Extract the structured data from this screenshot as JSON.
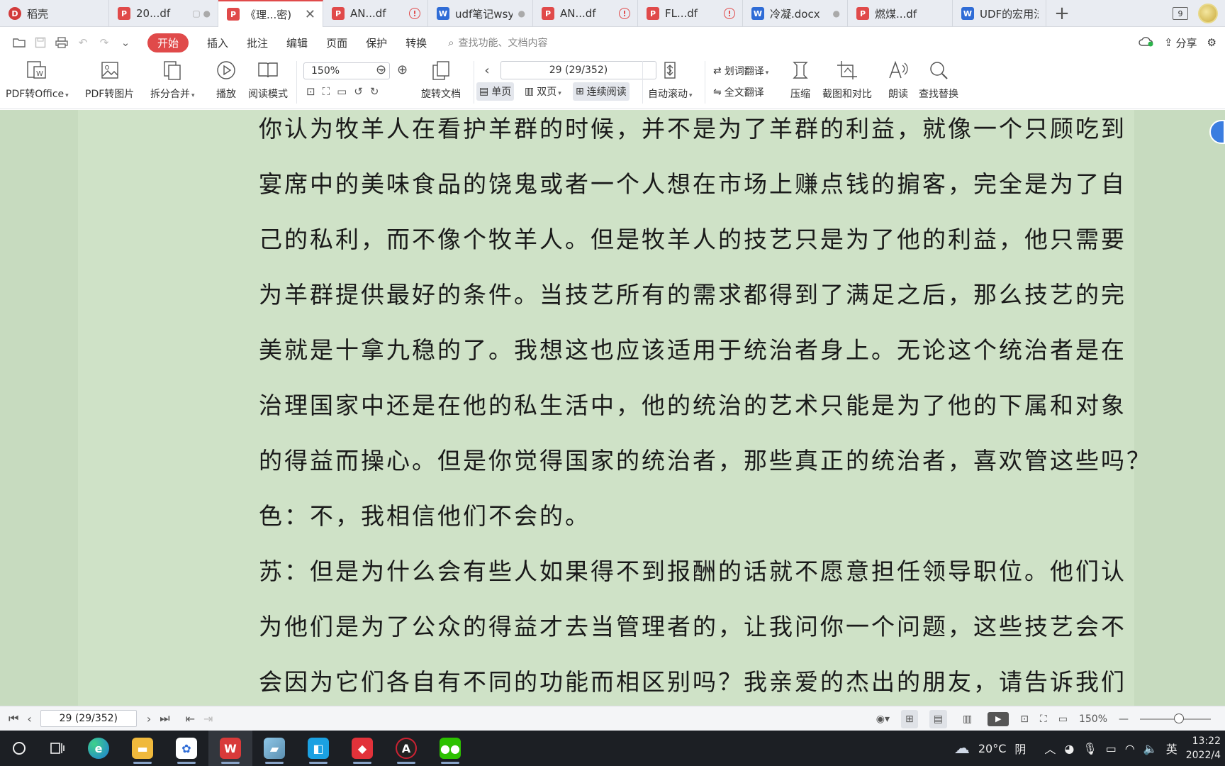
{
  "tabs": [
    {
      "label": "稻壳",
      "type": "logo",
      "state": ""
    },
    {
      "label": "20...df",
      "type": "pdf",
      "state": "dot"
    },
    {
      "label": "《理...密)",
      "type": "pdf",
      "state": "close",
      "active": true
    },
    {
      "label": "AN...df",
      "type": "pdf",
      "state": "alert"
    },
    {
      "label": "udf笔记wsy",
      "type": "doc",
      "state": "dot"
    },
    {
      "label": "AN...df",
      "type": "pdf",
      "state": "alert"
    },
    {
      "label": "FL...df",
      "type": "pdf",
      "state": "alert"
    },
    {
      "label": "冷凝.docx",
      "type": "doc",
      "state": "dot"
    },
    {
      "label": "燃煤...df",
      "type": "pdf",
      "state": ""
    },
    {
      "label": "UDF的宏用法",
      "type": "doc",
      "state": ""
    }
  ],
  "tab_add": "+",
  "window_badge": "9",
  "menu": {
    "items": [
      "开始",
      "插入",
      "批注",
      "编辑",
      "页面",
      "保护",
      "转换"
    ],
    "search_placeholder": "查找功能、文档内容",
    "share": "分享"
  },
  "ribbon": {
    "pdf_to_office": "PDF转Office",
    "pdf_to_image": "PDF转图片",
    "split_merge": "拆分合并",
    "play": "播放",
    "read_mode": "阅读模式",
    "zoom": "150%",
    "rotate_doc": "旋转文档",
    "page_display": "29 (29/352)",
    "single_page": "单页",
    "double_page": "双页",
    "continuous": "连续阅读",
    "auto_scroll": "自动滚动",
    "word_translate": "划词翻译",
    "full_translate": "全文翻译",
    "compress": "压缩",
    "screenshot_compare": "截图和对比",
    "read_aloud": "朗读",
    "find_replace": "查找替换"
  },
  "document": {
    "lines": [
      "你认为牧羊人在看护羊群的时候，并不是为了羊群的利益，就像一个只顾吃到",
      "宴席中的美味食品的饶鬼或者一个人想在市场上赚点钱的掮客，完全是为了自",
      "己的私利，而不像个牧羊人。但是牧羊人的技艺只是为了他的利益，他只需要",
      "为羊群提供最好的条件。当技艺所有的需求都得到了满足之后，那么技艺的完",
      "美就是十拿九稳的了。我想这也应该适用于统治者身上。无论这个统治者是在",
      "治理国家中还是在他的私生活中，他的统治的艺术只能是为了他的下属和对象",
      "的得益而操心。但是你觉得国家的统治者，那些真正的统治者，喜欢管这些吗？",
      "色：不，我相信他们不会的。",
      "苏：但是为什么会有些人如果得不到报酬的话就不愿意担任领导职位。他们认",
      "为他们是为了公众的得益才去当管理者的，让我问你一个问题，这些技艺会不",
      "会因为它们各自有不同的功能而相区别吗？我亲爱的杰出的朋友，请告诉我们"
    ]
  },
  "statusbar": {
    "page_display": "29 (29/352)",
    "zoom": "150%",
    "zoom_level": 0.55
  },
  "taskbar": {
    "weather_temp": "20°C",
    "weather_desc": "阴",
    "ime": "英",
    "time": "13:22",
    "date": "2022/4"
  },
  "colors": {
    "accent": "#e04a4a",
    "doc_background": "#cfe2c7",
    "doc_margin": "#c7dbbf",
    "taskbar": "#1c1f24"
  }
}
